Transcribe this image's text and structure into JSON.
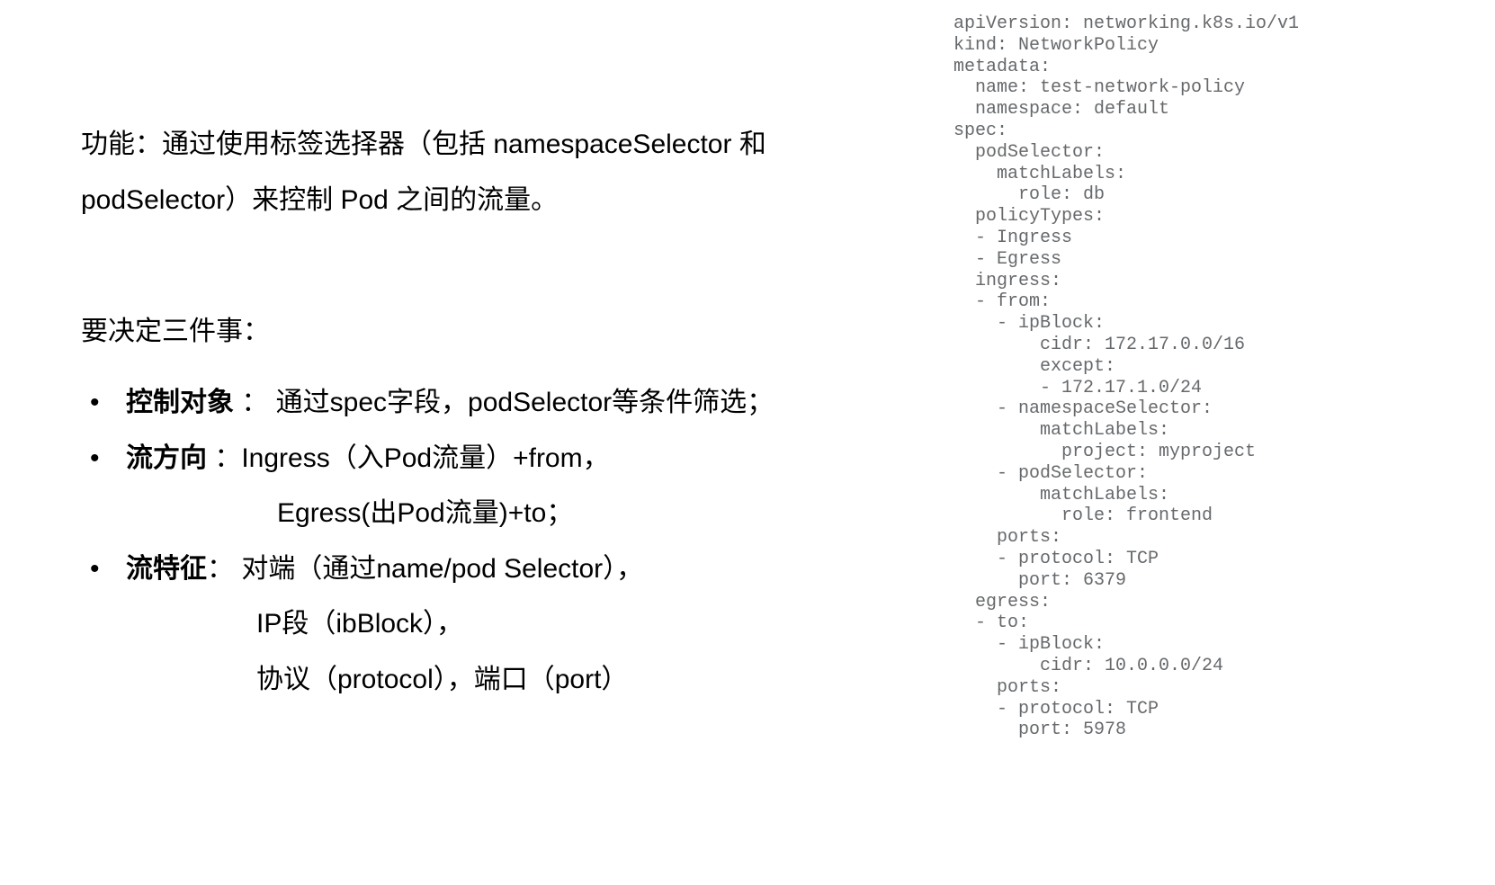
{
  "left": {
    "intro": "功能：通过使用标签选择器（包括 namespaceSelector 和 podSelector）来控制 Pod 之间的流量。",
    "decide": "要决定三件事：",
    "items": [
      {
        "label": "控制对象",
        "tail": " ： 通过spec字段，podSelector等条件筛选；",
        "subs": []
      },
      {
        "label": "流方向",
        "tail": " ：Ingress（入Pod流量）+from，",
        "subs": [
          "Egress(出Pod流量)+to；"
        ]
      },
      {
        "label": "流特征",
        "tail": "： 对端（通过name/pod Selector），",
        "subs": [
          "IP段（ibBlock），",
          "协议（protocol），端口（port）"
        ]
      }
    ]
  },
  "code": "apiVersion: networking.k8s.io/v1\nkind: NetworkPolicy\nmetadata:\n  name: test-network-policy\n  namespace: default\nspec:\n  podSelector:\n    matchLabels:\n      role: db\n  policyTypes:\n  - Ingress\n  - Egress\n  ingress:\n  - from:\n    - ipBlock:\n        cidr: 172.17.0.0/16\n        except:\n        - 172.17.1.0/24\n    - namespaceSelector:\n        matchLabels:\n          project: myproject\n    - podSelector:\n        matchLabels:\n          role: frontend\n    ports:\n    - protocol: TCP\n      port: 6379\n  egress:\n  - to:\n    - ipBlock:\n        cidr: 10.0.0.0/24\n    ports:\n    - protocol: TCP\n      port: 5978"
}
